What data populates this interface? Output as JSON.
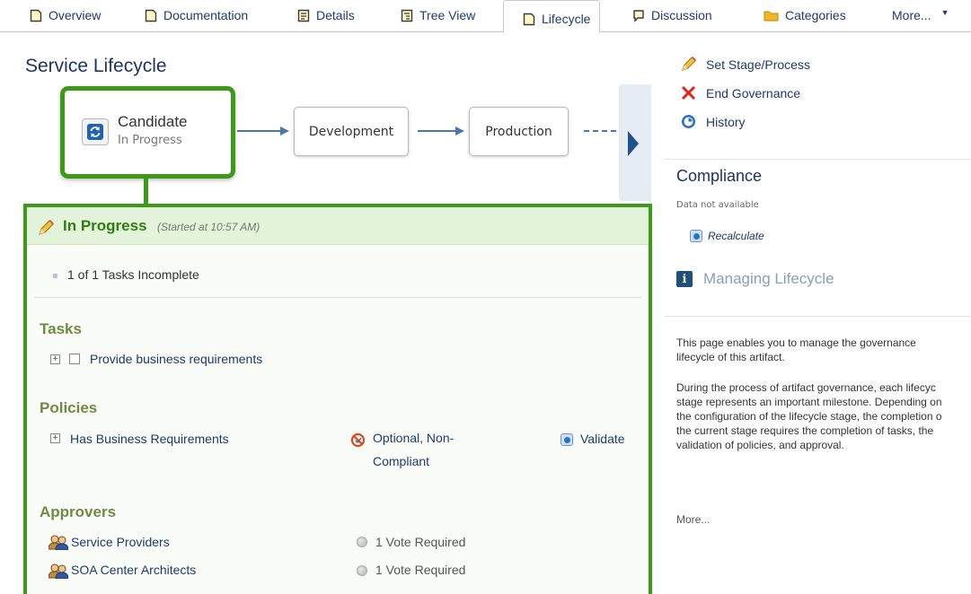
{
  "tabs": [
    {
      "label": "Overview",
      "icon": "document-icon"
    },
    {
      "label": "Documentation",
      "icon": "document-icon"
    },
    {
      "label": "Details",
      "icon": "details-icon"
    },
    {
      "label": "Tree View",
      "icon": "tree-view-icon"
    },
    {
      "label": "Lifecycle",
      "icon": "document-icon",
      "active": true
    },
    {
      "label": "Discussion",
      "icon": "speech-bubble-icon"
    },
    {
      "label": "Categories",
      "icon": "folder-icon"
    },
    {
      "label": "More...",
      "icon": "caret-down-icon"
    }
  ],
  "page_title": "Service Lifecycle",
  "flow": {
    "current": {
      "name": "Candidate",
      "state": "In Progress"
    },
    "next_stages": [
      "Development",
      "Production"
    ]
  },
  "progress": {
    "title": "In Progress",
    "started": "(Started at 10:57 AM)",
    "summary": "1 of 1 Tasks Incomplete",
    "tasks_title": "Tasks",
    "tasks": [
      {
        "label": "Provide business requirements"
      }
    ],
    "policies_title": "Policies",
    "policies": [
      {
        "label": "Has Business Requirements",
        "status_line1": "Optional, Non-",
        "status_line2": "Compliant",
        "action": "Validate"
      }
    ],
    "approvers_title": "Approvers",
    "approvers": [
      {
        "name": "Service Providers",
        "votes": "1 Vote Required"
      },
      {
        "name": "SOA Center Architects",
        "votes": "1 Vote Required"
      }
    ]
  },
  "actions": [
    {
      "label": "Set Stage/Process",
      "icon": "pencil-icon"
    },
    {
      "label": "End Governance",
      "icon": "red-x-icon"
    },
    {
      "label": "History",
      "icon": "history-icon"
    }
  ],
  "compliance": {
    "title": "Compliance",
    "status": "Data not available",
    "recalculate": "Recalculate"
  },
  "help": {
    "title": "Managing Lifecycle",
    "para1": [
      "This page enables you to manage the governance",
      "lifecycle of this artifact."
    ],
    "para2": [
      "During the process of artifact governance, each lifecyc",
      "stage represents an important milestone. Depending on",
      "the configuration of the lifecycle stage, the completion o",
      "the current stage requires the completion of tasks, the",
      "validation of policies, and approval."
    ],
    "more": "More..."
  },
  "colors": {
    "accent_green": "#3d9a19",
    "link_blue": "#1f3a6e",
    "section_olive": "#6f8a44",
    "panel_header": "#e3f4db"
  }
}
